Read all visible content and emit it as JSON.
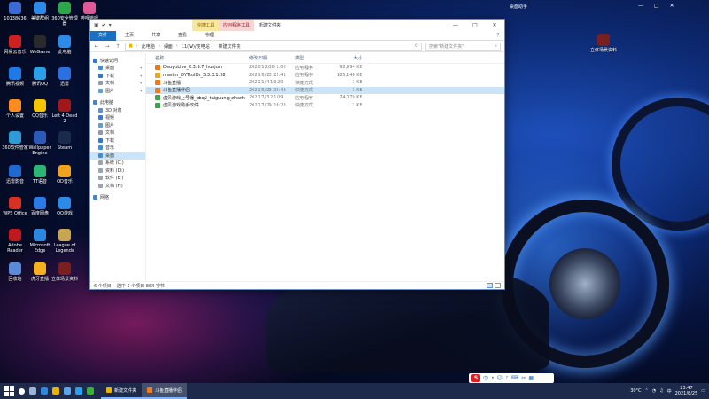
{
  "window": {
    "ctx_tab_1": "快捷工具",
    "ctx_tab_2": "应用程序工具",
    "ctx_tab_3": "新建文件夹",
    "ribbon": [
      "文件",
      "主页",
      "共享",
      "查看",
      "管理"
    ],
    "path": [
      "此电脑",
      "桌面",
      "11(W)/变电站",
      "新建文件夹"
    ],
    "search_placeholder": "搜索\"新建文件夹\""
  },
  "nav": {
    "quick_access": "快速访问",
    "pinned": [
      "桌面",
      "下载",
      "文档",
      "图片"
    ],
    "this_pc": "此电脑",
    "pc_items": [
      "3D 对象",
      "视频",
      "图片",
      "文档",
      "下载",
      "音乐",
      "桌面",
      "系统 (C:)",
      "资料 (D:)",
      "软件 (E:)",
      "文档 (F:)"
    ],
    "network": "网络"
  },
  "columns": {
    "name": "名称",
    "date": "修改日期",
    "type": "类型",
    "size": "大小"
  },
  "files": [
    {
      "name": "DouyuLive_6.3.8.7_huajun",
      "date": "2020/12/30 1:06",
      "type": "应用程序",
      "size": "92,994 KB",
      "color": "#e87a1e"
    },
    {
      "name": "master_DYTool8x_5.3.3.1.98",
      "date": "2021/6/23 22:41",
      "type": "应用程序",
      "size": "185,146 KB",
      "color": "#e8a81e"
    },
    {
      "name": "斗鱼直播",
      "date": "2021/1/4 19:29",
      "type": "快捷方式",
      "size": "1 KB",
      "color": "#f07a20"
    },
    {
      "name": "斗鱼直播伴侣",
      "date": "2021/6/23 22:43",
      "type": "快捷方式",
      "size": "1 KB",
      "color": "#f07a20"
    },
    {
      "name": "虚贝游戏上号器_xbq2_tuiguang_zhezhe...",
      "date": "2021/7/3 21:09",
      "type": "应用程序",
      "size": "74,079 KB",
      "color": "#3fa34d"
    },
    {
      "name": "虚贝游戏助手软件",
      "date": "2021/7/29 19:28",
      "type": "快捷方式",
      "size": "1 KB",
      "color": "#3fa34d"
    }
  ],
  "status": {
    "count": "6 个项目",
    "selected": "选中 1 个项目  864 字节"
  },
  "desktop": {
    "right_title": "桌面助手",
    "icons": [
      {
        "label": "10138636",
        "color": "#3a6ad6"
      },
      {
        "label": "美键群组",
        "color": "#2c8ae8"
      },
      {
        "label": "360安全管理器",
        "color": "#2ca84a"
      },
      {
        "label": "哔哩哔哩",
        "color": "#e05a9a"
      },
      {
        "label": "网易云音乐",
        "color": "#d02020"
      },
      {
        "label": "WeGame",
        "color": "#2a2a2a"
      },
      {
        "label": "此电脑",
        "color": "#2c8ae8"
      },
      {
        "label": "腾讯视频",
        "color": "#1e7ae6"
      },
      {
        "label": "腾讯QQ",
        "color": "#2aa0e8"
      },
      {
        "label": "迅雷",
        "color": "#2c6fe0"
      },
      {
        "label": "个人设置",
        "color": "#ff8a1e"
      },
      {
        "label": "QQ音乐",
        "color": "#f5c400"
      },
      {
        "label": "Left 4 Dead 2",
        "color": "#a01818"
      },
      {
        "label": "360软件管家",
        "color": "#2c9bd8"
      },
      {
        "label": "Wallpaper Engine",
        "color": "#2b5ab8"
      },
      {
        "label": "Steam",
        "color": "#1a2a4a"
      },
      {
        "label": "迅雷影音",
        "color": "#1e6ad0"
      },
      {
        "label": "TT语音",
        "color": "#2bb673"
      },
      {
        "label": "OD音乐",
        "color": "#f3a21f"
      },
      {
        "label": "WPS Office",
        "color": "#d93026"
      },
      {
        "label": "百度网盘",
        "color": "#2a7ae8"
      },
      {
        "label": "QQ游戏",
        "color": "#2c8ae8"
      },
      {
        "label": "Adobe Reader",
        "color": "#c0191d"
      },
      {
        "label": "Microsoft Edge",
        "color": "#2b8adf"
      },
      {
        "label": "League of Legends",
        "color": "#c8a650"
      },
      {
        "label": "回收站",
        "color": "#5b8ad8"
      },
      {
        "label": "虎牙直播",
        "color": "#f5b21e"
      },
      {
        "label": "立体场景资料",
        "color": "#7a1f1f"
      }
    ]
  },
  "ime": {
    "logo": "S"
  },
  "taskbar": {
    "apps": [
      "新建文件夹",
      "斗鱼直播伴侣"
    ],
    "time": "23:47",
    "date": "2021/8/25",
    "weather": "30°C",
    "lang": "中"
  }
}
